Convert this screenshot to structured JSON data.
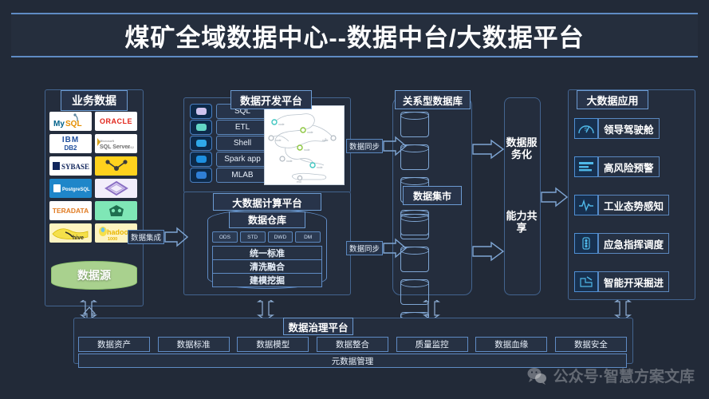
{
  "banner": {
    "title": "煤矿全域数据中心--数据中台/大数据平台"
  },
  "business_data": {
    "title": "业务数据",
    "logos": [
      {
        "name": "mysql",
        "label": "MySQL"
      },
      {
        "name": "oracle",
        "label": "ORACLE"
      },
      {
        "name": "ibm-db2",
        "label": "IBM DB2"
      },
      {
        "name": "sql-server",
        "label": "SQL Server"
      },
      {
        "name": "sybase",
        "label": "SYBASE"
      },
      {
        "name": "tile-yellow",
        "label": ""
      },
      {
        "name": "postgresql",
        "label": "PostgreSQL"
      },
      {
        "name": "tile-purple",
        "label": ""
      },
      {
        "name": "teradata",
        "label": "TERADATA"
      },
      {
        "name": "tile-green",
        "label": ""
      },
      {
        "name": "hive",
        "label": "hive"
      },
      {
        "name": "hadoop",
        "label": "hadoop"
      }
    ],
    "data_source_label": "数据源"
  },
  "dev_platform": {
    "title": "数据开发平台",
    "items": [
      {
        "label": "SQL",
        "icon_color": "#cfc4ee"
      },
      {
        "label": "ETL",
        "icon_color": "#63d6c6"
      },
      {
        "label": "Shell",
        "icon_color": "#2fa8e8"
      },
      {
        "label": "Spark app",
        "icon_color": "#1d8fe0"
      },
      {
        "label": "MLAB",
        "icon_color": "#2f7fd6"
      }
    ]
  },
  "calc_platform": {
    "title": "大数据计算平台",
    "warehouse_label": "数据仓库",
    "layers": [
      "ODS",
      "STD",
      "DWD",
      "DM"
    ],
    "capabilities": [
      "统一标准",
      "清洗融合",
      "建模挖掘"
    ]
  },
  "relational_db": {
    "title": "关系型数据库",
    "mart_label": "数据集市",
    "cylinder_count_top": 4,
    "cylinder_count_bottom": 4
  },
  "service_column": {
    "line1": "数据服务化",
    "line2": "能力共享"
  },
  "applications": {
    "title": "大数据应用",
    "items": [
      {
        "label": "领导驾驶舱",
        "icon": "cockpit-icon"
      },
      {
        "label": "高风险预警",
        "icon": "alert-bars-icon"
      },
      {
        "label": "工业态势感知",
        "icon": "pulse-wave-icon"
      },
      {
        "label": "应急指挥调度",
        "icon": "traffic-light-icon"
      },
      {
        "label": "智能开采掘进",
        "icon": "mining-icon"
      }
    ]
  },
  "governance": {
    "title": "数据治理平台",
    "items": [
      "数据资产",
      "数据标准",
      "数据模型",
      "数据整合",
      "质量监控",
      "数据血缘",
      "数据安全"
    ],
    "meta_label": "元数据管理"
  },
  "flows": {
    "integration": "数据集成",
    "sync_top": "数据同步",
    "sync_bottom": "数据同步"
  },
  "watermark": {
    "text": "公众号·智慧方案文库"
  },
  "colors": {
    "background": "#222a38",
    "accent_border": "#5f8bc4",
    "panel_fill": "#242d3d",
    "title_text": "#ffffff",
    "data_source_green": "#a9d18e"
  }
}
